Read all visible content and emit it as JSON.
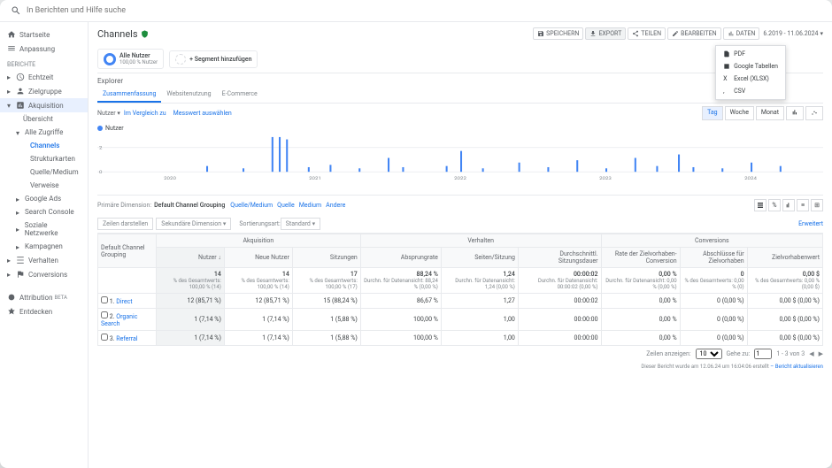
{
  "search_placeholder": "In Berichten und Hilfe suche",
  "sidebar": {
    "section_label": "BERICHTE",
    "items": [
      {
        "label": "Startseite"
      },
      {
        "label": "Anpassung"
      },
      {
        "label": "Echtzeit"
      },
      {
        "label": "Zielgruppe"
      },
      {
        "label": "Akquisition"
      },
      {
        "label": "Übersicht"
      },
      {
        "label": "Alle Zugriffe"
      },
      {
        "label": "Channels"
      },
      {
        "label": "Strukturkarten"
      },
      {
        "label": "Quelle/Medium"
      },
      {
        "label": "Verweise"
      },
      {
        "label": "Google Ads"
      },
      {
        "label": "Search Console"
      },
      {
        "label": "Soziale Netzwerke"
      },
      {
        "label": "Kampagnen"
      },
      {
        "label": "Verhalten"
      },
      {
        "label": "Conversions"
      },
      {
        "label": "Attribution"
      },
      {
        "label": "Entdecken"
      }
    ]
  },
  "page_title": "Channels",
  "toolbar": {
    "save": "SPEICHERN",
    "export": "EXPORT",
    "share": "TEILEN",
    "edit": "BEARBEITEN",
    "stats": "DATEN"
  },
  "export_menu": [
    "PDF",
    "Google Tabellen",
    "Excel (XLSX)",
    "CSV"
  ],
  "date_range": "6.2019 - 11.06.2024",
  "segment": {
    "title": "Alle Nutzer",
    "sub": "100,00 % Nutzer",
    "add": "+ Segment hinzufügen"
  },
  "explorer": {
    "label": "Explorer",
    "tabs": [
      "Zusammenfassung",
      "Websitenutzung",
      "E-Commerce"
    ],
    "metric_label": "Nutzer",
    "compare": "Im Vergleich zu",
    "measure_link": "Messwert auswählen",
    "view_tabs": [
      "Tag",
      "Woche",
      "Monat"
    ],
    "legend": "Nutzer"
  },
  "chart_data": {
    "type": "bar",
    "x_ticks": [
      "2020",
      "2021",
      "2022",
      "2023",
      "2024"
    ],
    "ylim": [
      0,
      3
    ],
    "series": [
      {
        "name": "Nutzer",
        "color": "#4285f4",
        "values": [
          {
            "x": 0.15,
            "y": 0.5
          },
          {
            "x": 0.2,
            "y": 0.3
          },
          {
            "x": 0.24,
            "y": 3
          },
          {
            "x": 0.25,
            "y": 3
          },
          {
            "x": 0.26,
            "y": 2.8
          },
          {
            "x": 0.29,
            "y": 0.4
          },
          {
            "x": 0.32,
            "y": 0.6
          },
          {
            "x": 0.36,
            "y": 0.3
          },
          {
            "x": 0.4,
            "y": 1.2
          },
          {
            "x": 0.42,
            "y": 0.4
          },
          {
            "x": 0.48,
            "y": 0.5
          },
          {
            "x": 0.5,
            "y": 1.8
          },
          {
            "x": 0.53,
            "y": 0.3
          },
          {
            "x": 0.58,
            "y": 0.8
          },
          {
            "x": 0.62,
            "y": 0.4
          },
          {
            "x": 0.66,
            "y": 1.0
          },
          {
            "x": 0.7,
            "y": 0.3
          },
          {
            "x": 0.74,
            "y": 1.2
          },
          {
            "x": 0.77,
            "y": 0.5
          },
          {
            "x": 0.8,
            "y": 1.5
          },
          {
            "x": 0.82,
            "y": 0.4
          },
          {
            "x": 0.86,
            "y": 0.3
          },
          {
            "x": 0.9,
            "y": 0.8
          },
          {
            "x": 0.94,
            "y": 0.5
          }
        ]
      }
    ]
  },
  "dimensions": {
    "primary_label": "Primäre Dimension:",
    "primary": "Default Channel Grouping",
    "links": [
      "Quelle/Medium",
      "Quelle",
      "Medium",
      "Andere"
    ],
    "secondary": "Sekundäre Dimension",
    "plot_rows": "Zeilen darstellen",
    "sort_type_label": "Sortierungsart:",
    "sort_type": "Standard",
    "advanced": "Erweitert"
  },
  "table": {
    "groups": [
      "Akquisition",
      "Verhalten",
      "Conversions"
    ],
    "dim_col": "Default Channel Grouping",
    "cols": [
      "Nutzer",
      "Neue Nutzer",
      "Sitzungen",
      "Absprungrate",
      "Seiten/Sitzung",
      "Durchschnittl. Sitzungsdauer",
      "Rate der Zielvorhaben-Conversion",
      "Abschlüsse für Zielvorhaben",
      "Zielvorhabenwert"
    ],
    "summary": {
      "values": [
        "14",
        "14",
        "17",
        "88,24 %",
        "1,24",
        "00:00:02",
        "0,00 %",
        "0",
        "0,00 $"
      ],
      "subs": [
        "% des Gesamtwerts: 100,00 % (14)",
        "% des Gesamtwerts: 100,00 % (14)",
        "% des Gesamtwerts: 100,00 % (17)",
        "Durchn. für Datenansicht: 88,24 % (0,00 %)",
        "Durchn. für Datenansicht: 1,24 (0,00 %)",
        "Durchn. für Datenansicht: 00:00:02 (0,00 %)",
        "Durchn. für Datenansicht: 0,00 % (0,00 %)",
        "% des Gesamtwerts: 0,00 % (0)",
        "% des Gesamtwerts: 0,00 % (0,00 $)"
      ]
    },
    "rows": [
      {
        "n": "1.",
        "name": "Direct",
        "v": [
          "12 (85,71 %)",
          "12 (85,71 %)",
          "15 (88,24 %)",
          "86,67 %",
          "1,27",
          "00:00:02",
          "0,00 %",
          "0 (0,00 %)",
          "0,00 $ (0,00 %)"
        ]
      },
      {
        "n": "2.",
        "name": "Organic Search",
        "v": [
          "1 (7,14 %)",
          "1 (7,14 %)",
          "1 (5,88 %)",
          "100,00 %",
          "1,00",
          "00:00:00",
          "0,00 %",
          "0 (0,00 %)",
          "0,00 $ (0,00 %)"
        ]
      },
      {
        "n": "3.",
        "name": "Referral",
        "v": [
          "1 (7,14 %)",
          "1 (7,14 %)",
          "1 (5,88 %)",
          "100,00 %",
          "1,00",
          "00:00:00",
          "0,00 %",
          "0 (0,00 %)",
          "0,00 $ (0,00 %)"
        ]
      }
    ]
  },
  "pagination": {
    "rows_label": "Zeilen anzeigen:",
    "rows_val": "10",
    "goto_label": "Gehe zu:",
    "goto_val": "1",
    "range": "1 - 3 von 3"
  },
  "footer": {
    "generated": "Dieser Bericht wurde am 12.06.24 um 16:04:06 erstellt",
    "refresh": "– Bericht aktualisieren"
  }
}
